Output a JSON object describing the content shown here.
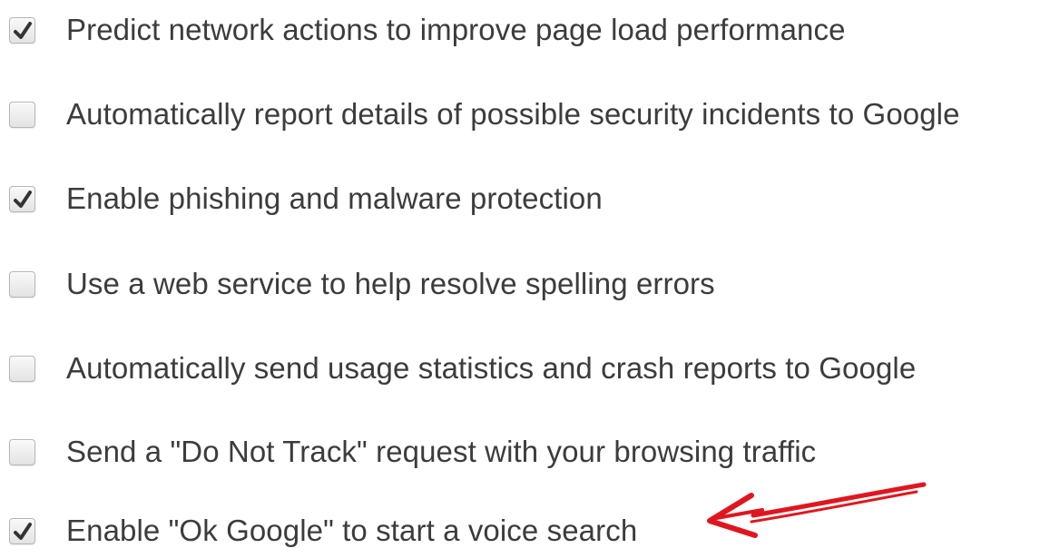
{
  "settings": [
    {
      "label": "Predict network actions to improve page load performance",
      "checked": true
    },
    {
      "label": "Automatically report details of possible security incidents to Google",
      "checked": false
    },
    {
      "label": "Enable phishing and malware protection",
      "checked": true
    },
    {
      "label": "Use a web service to help resolve spelling errors",
      "checked": false
    },
    {
      "label": "Automatically send usage statistics and crash reports to Google",
      "checked": false
    },
    {
      "label": "Send a \"Do Not Track\" request with your browsing traffic",
      "checked": false
    },
    {
      "label": "Enable \"Ok Google\" to start a voice search",
      "checked": true
    }
  ],
  "colors": {
    "text": "#3c3c3c",
    "checkmark": "#333333",
    "annotation": "#e0161e"
  }
}
